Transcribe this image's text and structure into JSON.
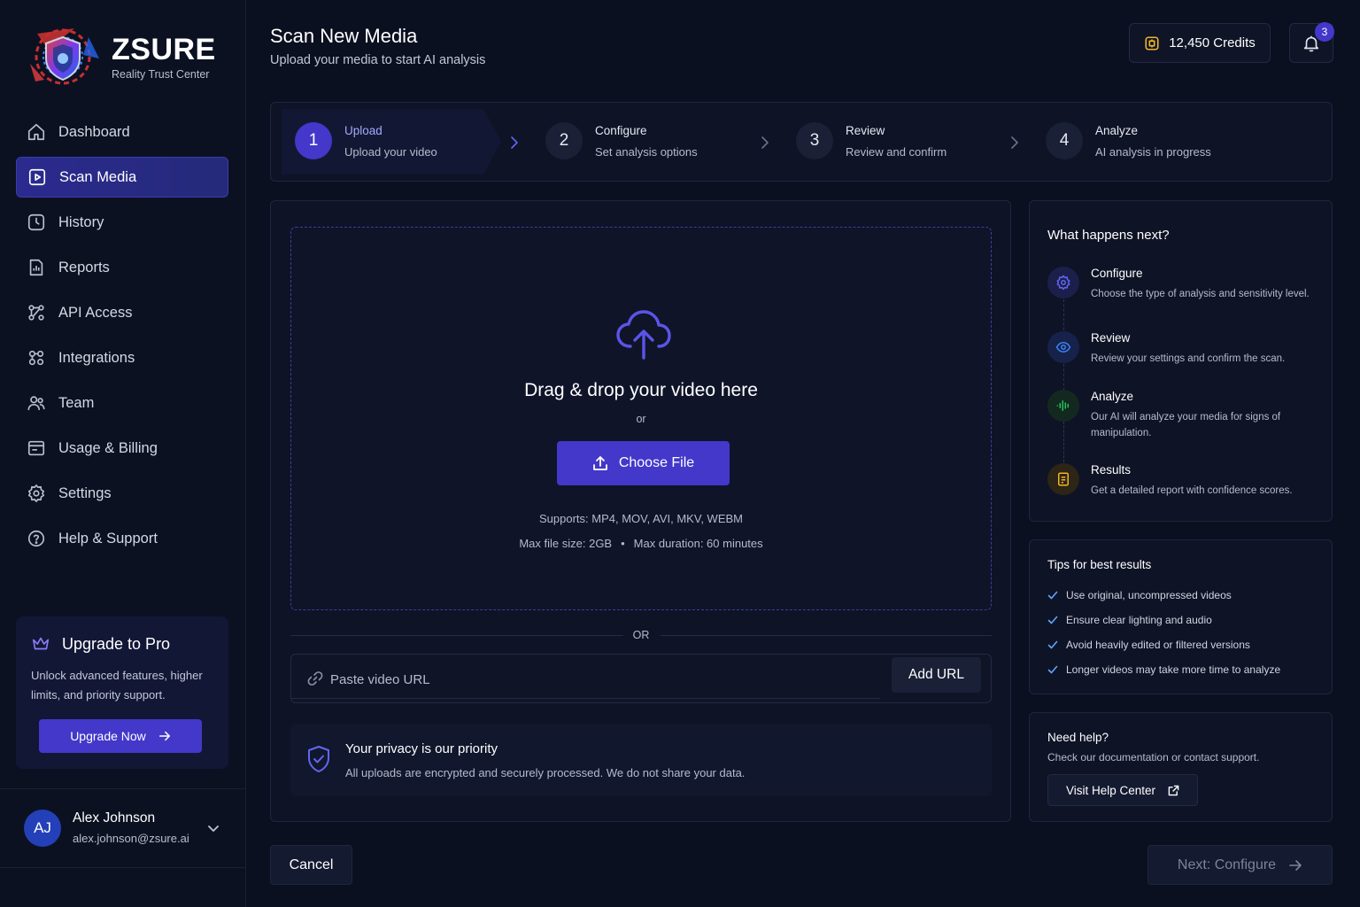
{
  "brand": {
    "name": "ZSURE",
    "tagline": "Reality Trust Center",
    "logo_icon": "shield-logo-icon"
  },
  "sidebar": {
    "items": [
      {
        "label": "Dashboard",
        "icon": "home-icon",
        "active": false
      },
      {
        "label": "Scan Media",
        "icon": "play-square-icon",
        "active": true
      },
      {
        "label": "History",
        "icon": "clock-icon",
        "active": false
      },
      {
        "label": "Reports",
        "icon": "report-icon",
        "active": false
      },
      {
        "label": "API Access",
        "icon": "api-icon",
        "active": false
      },
      {
        "label": "Integrations",
        "icon": "integrations-icon",
        "active": false
      },
      {
        "label": "Team",
        "icon": "team-icon",
        "active": false
      },
      {
        "label": "Usage & Billing",
        "icon": "billing-icon",
        "active": false
      },
      {
        "label": "Settings",
        "icon": "gear-icon",
        "active": false
      },
      {
        "label": "Help & Support",
        "icon": "help-icon",
        "active": false
      }
    ],
    "upgrade": {
      "title": "Upgrade to Pro",
      "description": "Unlock advanced features, higher limits, and priority support.",
      "button": "Upgrade Now",
      "icon": "crown-icon"
    },
    "user": {
      "initials": "AJ",
      "name": "Alex Johnson",
      "email": "alex.johnson@zsure.ai"
    }
  },
  "header": {
    "title": "Scan New Media",
    "subtitle": "Upload your media to start AI analysis",
    "credits": "12,450 Credits",
    "notification_count": "3"
  },
  "stepper": {
    "steps": [
      {
        "number": "1",
        "label": "Upload",
        "description": "Upload your video",
        "active": true
      },
      {
        "number": "2",
        "label": "Configure",
        "description": "Set analysis options",
        "active": false
      },
      {
        "number": "3",
        "label": "Review",
        "description": "Review and confirm",
        "active": false
      },
      {
        "number": "4",
        "label": "Analyze",
        "description": "AI analysis in progress",
        "active": false
      }
    ]
  },
  "upload": {
    "drop_title": "Drag & drop your video here",
    "or_small": "or",
    "choose_button": "Choose File",
    "supports": "Supports: MP4, MOV, AVI, MKV, WEBM",
    "max_size": "Max file size: 2GB",
    "separator_dot": "•",
    "max_duration": "Max duration: 60 minutes",
    "or_divider": "OR",
    "url_placeholder": "Paste video URL",
    "add_url_button": "Add URL",
    "privacy_title": "Your privacy is our priority",
    "privacy_desc": "All uploads are encrypted and securely processed. We do not share your data."
  },
  "next_steps": {
    "title": "What happens next?",
    "items": [
      {
        "label": "Configure",
        "description": "Choose the type of analysis and sensitivity level.",
        "icon": "gear-icon",
        "color": "#6366f1"
      },
      {
        "label": "Review",
        "description": "Review your settings and confirm the scan.",
        "icon": "eye-icon",
        "color": "#3b82f6"
      },
      {
        "label": "Analyze",
        "description": "Our AI will analyze your media for signs of manipulation.",
        "icon": "waveform-icon",
        "color": "#22c55e"
      },
      {
        "label": "Results",
        "description": "Get a detailed report with confidence scores.",
        "icon": "document-icon",
        "color": "#f0b429"
      }
    ]
  },
  "tips": {
    "title": "Tips for best results",
    "items": [
      "Use original, uncompressed videos",
      "Ensure clear lighting and audio",
      "Avoid heavily edited or filtered versions",
      "Longer videos may take more time to analyze"
    ]
  },
  "help": {
    "title": "Need help?",
    "description": "Check our documentation or contact support.",
    "button": "Visit Help Center"
  },
  "footer": {
    "cancel": "Cancel",
    "next": "Next: Configure"
  },
  "colors": {
    "accent": "#4338ca",
    "background": "#0b1020",
    "credits_icon": "#f0b429",
    "tip_check": "#60a5fa"
  }
}
